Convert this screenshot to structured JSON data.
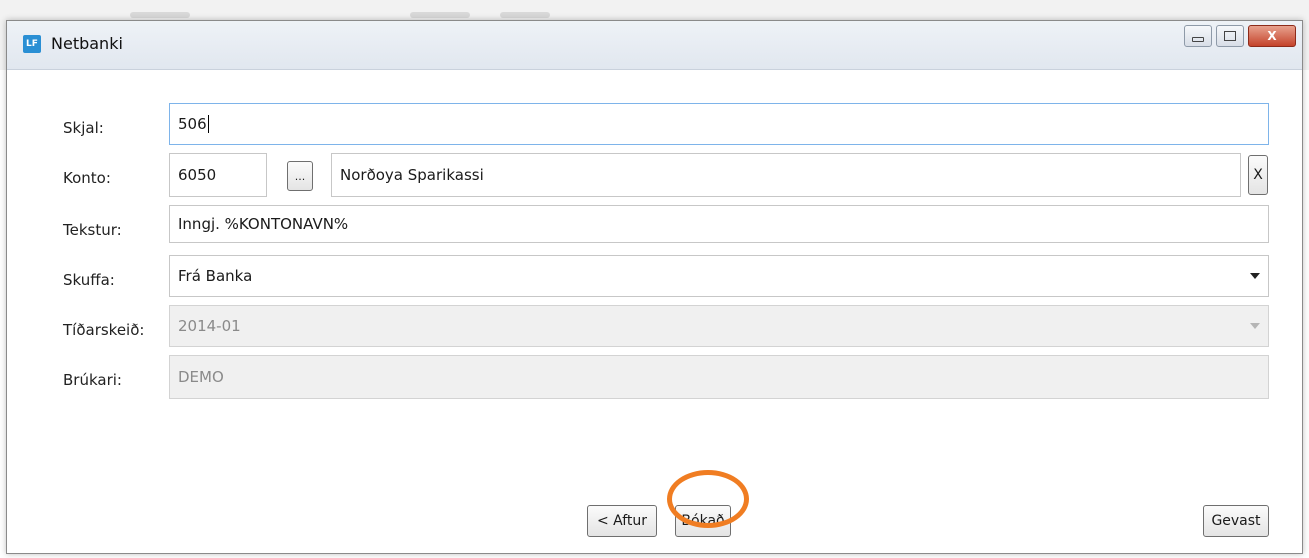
{
  "window": {
    "title": "Netbanki",
    "icon_text": "LF",
    "close_glyph": "X"
  },
  "form": {
    "skjal": {
      "label": "Skjal:",
      "value": "506"
    },
    "konto": {
      "label": "Konto:",
      "number": "6050",
      "browse": "...",
      "name": "Norðoya Sparikassi",
      "clear": "X"
    },
    "tekstur": {
      "label": "Tekstur:",
      "value": "Inngj. %KONTONAVN%"
    },
    "skuffa": {
      "label": "Skuffa:",
      "value": "Frá Banka"
    },
    "tidarskeid": {
      "label": "Tíðarskeið:",
      "value": "2014-01"
    },
    "brukari": {
      "label": "Brúkari:",
      "value": "DEMO"
    }
  },
  "buttons": {
    "back": "< Aftur",
    "post": "Bókað",
    "cancel": "Gevast"
  },
  "colors": {
    "accent": "#7eb4ea",
    "highlight": "#f07d22",
    "app_icon": "#2a8fd4"
  }
}
